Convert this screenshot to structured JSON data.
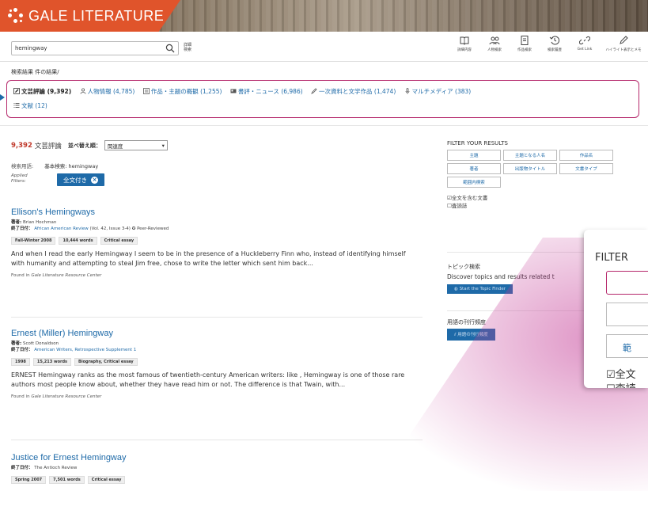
{
  "header": {
    "brand": "GALE LITERATURE"
  },
  "toolbar": {
    "search_value": "hemingway",
    "advanced_label": "詳細検索",
    "tools": [
      {
        "icon": "book-icon",
        "label": "詳細内容"
      },
      {
        "icon": "people-icon",
        "label": "人物検索"
      },
      {
        "icon": "document-icon",
        "label": "作品検索"
      },
      {
        "icon": "history-icon",
        "label": "検索履歴"
      },
      {
        "icon": "link-icon",
        "label": "Get Link"
      },
      {
        "icon": "pen-icon",
        "label": "ハイライト表示とメモ"
      }
    ]
  },
  "summary": {
    "crumb": "検索結果 件の結果/",
    "content_types": [
      {
        "label": "文芸評論 (9,392)",
        "active": true
      },
      {
        "label": "人物情報 (4,785)",
        "active": false
      },
      {
        "label": "作品・主題の概観 (1,255)",
        "active": false
      },
      {
        "label": "書評・ニュース (6,986)",
        "active": false
      },
      {
        "label": "一次資料と文学作品 (1,474)",
        "active": false
      },
      {
        "label": "マルチメディア (383)",
        "active": false
      },
      {
        "label": "文献 (12)",
        "active": false
      }
    ]
  },
  "results_header": {
    "count": "9,392",
    "count_label": "文芸評論",
    "sort_label": "並べ替え順：",
    "sort_value": "関連度",
    "terms_label": "検索用語:",
    "terms_value": "基本検索: hemingway",
    "applied_label": "Applied Filters:",
    "applied_chip": "全文付き"
  },
  "results": [
    {
      "title": "Ellison's Hemingways",
      "author_label": "著者:",
      "author": "Brian Hochman",
      "pub_label": "終了日付：",
      "pub": "African American Review",
      "pub_detail": "(Vol. 42, Issue 3-4)",
      "peer": "Peer-Reviewed",
      "tags": [
        "Fall-Winter 2008",
        "10,444 words",
        "Critical essay"
      ],
      "snippet": "And when I read the early Hemingway I seem to be in the presence of a Huckleberry Finn who, instead of identifying himself with humanity and attempting to steal Jim free, chose to write the letter which sent him back...",
      "found_prefix": "Found in",
      "found_source": "Gale Literature Resource Center"
    },
    {
      "title": "Ernest (Miller) Hemingway",
      "author_label": "著者:",
      "author": "Scott Donaldson",
      "pub_label": "終了日付：",
      "pub": "American Writers, Retrospective Supplement 1",
      "tags": [
        "1998",
        "15,213 words",
        "Biography, Critical essay"
      ],
      "snippet": "ERNEST Hemingway ranks as the most famous of twentieth-century American writers: like , Hemingway is one of those rare authors most people know about, whether they have read him or not. The difference is that Twain, with...",
      "found_prefix": "Found in",
      "found_source": "Gale Literature Resource Center"
    },
    {
      "title": "Justice for Ernest Hemingway",
      "pub_label": "終了日付：",
      "pub": "The Antioch Review",
      "tags": [
        "Spring 2007",
        "7,501 words",
        "Critical essay"
      ]
    }
  ],
  "filters": {
    "title": "FILTER YOUR RESULTS",
    "buttons": [
      "主題",
      "主題となる人名",
      "作品名",
      "著者",
      "出版物タイトル",
      "文書タイプ",
      "範囲内検索"
    ],
    "checks": [
      "全文を含む文書",
      "査読誌"
    ]
  },
  "topic": {
    "heading": "トピック検索",
    "desc": "Discover topics and results related t",
    "button": "Start the Topic Finder"
  },
  "frequency": {
    "heading": "用語の刊行頻度",
    "button": "用語の刊行頻度"
  },
  "zoom": {
    "title": "FILTER",
    "button3": "範",
    "check1": "全文",
    "check2": "査読"
  }
}
